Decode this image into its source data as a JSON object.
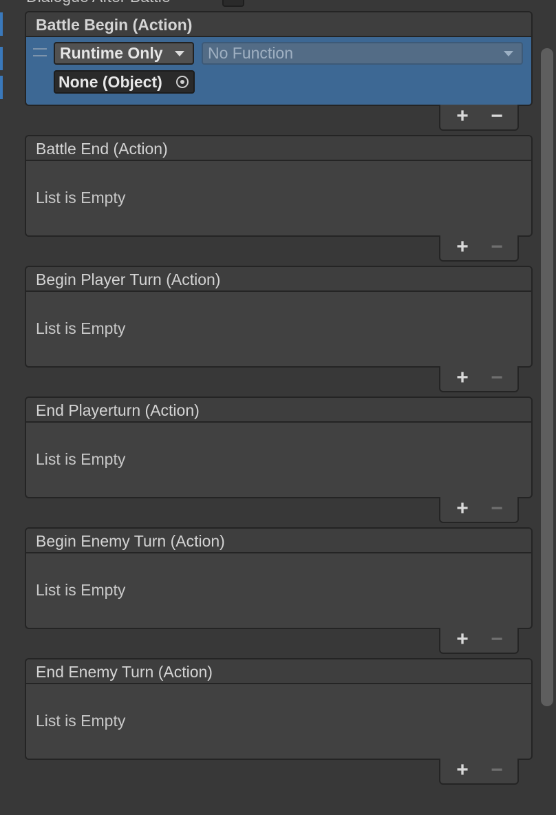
{
  "top_field": {
    "label": "Dialogue After Battle"
  },
  "events": [
    {
      "title": "Battle Begin (Action)",
      "empty_text": "",
      "listener": {
        "runtime_mode": "Runtime Only",
        "function": "No Function",
        "target_object": "None (Object)"
      },
      "add_symbol": "+",
      "remove_symbol": "−",
      "remove_enabled": true
    },
    {
      "title": "Battle End (Action)",
      "empty_text": "List is Empty",
      "add_symbol": "+",
      "remove_symbol": "−",
      "remove_enabled": false
    },
    {
      "title": "Begin Player Turn (Action)",
      "empty_text": "List is Empty",
      "add_symbol": "+",
      "remove_symbol": "−",
      "remove_enabled": false
    },
    {
      "title": "End Playerturn (Action)",
      "empty_text": "List is Empty",
      "add_symbol": "+",
      "remove_symbol": "−",
      "remove_enabled": false
    },
    {
      "title": "Begin Enemy Turn (Action)",
      "empty_text": "List is Empty",
      "add_symbol": "+",
      "remove_symbol": "−",
      "remove_enabled": false
    },
    {
      "title": "End Enemy Turn (Action)",
      "empty_text": "List is Empty",
      "add_symbol": "+",
      "remove_symbol": "−",
      "remove_enabled": false
    }
  ],
  "icons": {
    "drag_handle": "drag-handle-icon",
    "dropdown": "chevron-down-icon",
    "object_picker": "target-icon"
  },
  "colors": {
    "background": "#383838",
    "selection": "#3d6894",
    "accent_bar": "#3a79bb"
  }
}
